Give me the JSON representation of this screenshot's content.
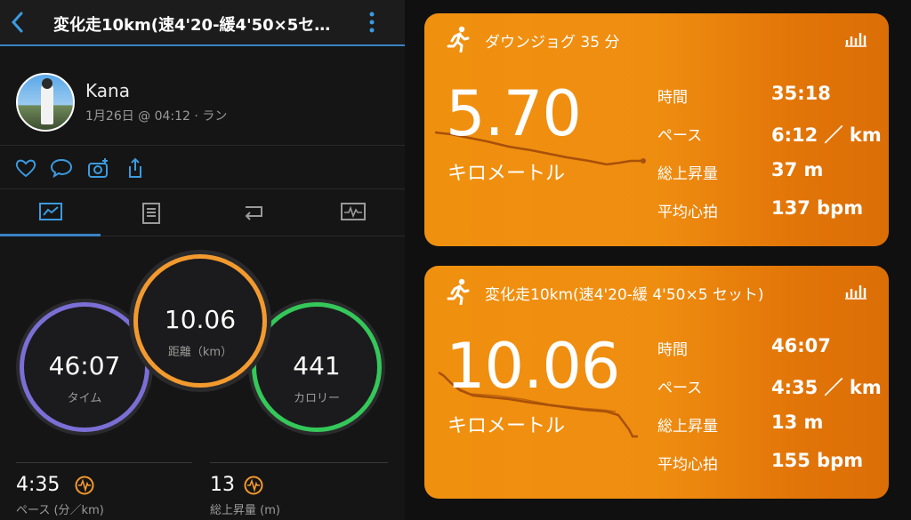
{
  "header": {
    "title": "変化走10km(速4'20-緩4'50×5セ…"
  },
  "profile": {
    "name": "Kana",
    "meta": "1月26日 @ 04:12 · ラン"
  },
  "rings": {
    "time": {
      "value": "46:07",
      "label": "タイム"
    },
    "distance": {
      "value": "10.06",
      "label": "距離（km）"
    },
    "calories": {
      "value": "441",
      "label": "カロリー"
    }
  },
  "stats": [
    {
      "value": "4:35",
      "label": "ペース (分／km)"
    },
    {
      "value": "13",
      "label": "総上昇量 (m)"
    }
  ],
  "cards": [
    {
      "title": "ダウンジョグ 35 分",
      "distance": "5.70",
      "unit": "キロメートル",
      "rows": [
        {
          "label": "時間",
          "value": "35:18"
        },
        {
          "label": "ペース",
          "value": "6:12 ／ km"
        },
        {
          "label": "総上昇量",
          "value": "37 m"
        },
        {
          "label": "平均心拍",
          "value": "137 bpm"
        }
      ]
    },
    {
      "title": "変化走10km(速4'20-緩 4'50×5 セット)",
      "distance": "10.06",
      "unit": "キロメートル",
      "rows": [
        {
          "label": "時間",
          "value": "46:07"
        },
        {
          "label": "ペース",
          "value": "4:35 ／ km"
        },
        {
          "label": "総上昇量",
          "value": "13 m"
        },
        {
          "label": "平均心拍",
          "value": "155 bpm"
        }
      ]
    }
  ],
  "colors": {
    "accent": "#3b82c4",
    "time_ring": "#7b6fd6",
    "distance_ring": "#f39a2e",
    "calorie_ring": "#34c759",
    "card": "#ef8d10"
  },
  "icons": [
    "back-icon",
    "kebab-icon",
    "heart-icon",
    "comment-icon",
    "add-photo-icon",
    "share-icon",
    "overview-tab-icon",
    "details-tab-icon",
    "laps-tab-icon",
    "charts-tab-icon",
    "heart-rate-icon",
    "runner-icon",
    "bar-chart-icon"
  ]
}
